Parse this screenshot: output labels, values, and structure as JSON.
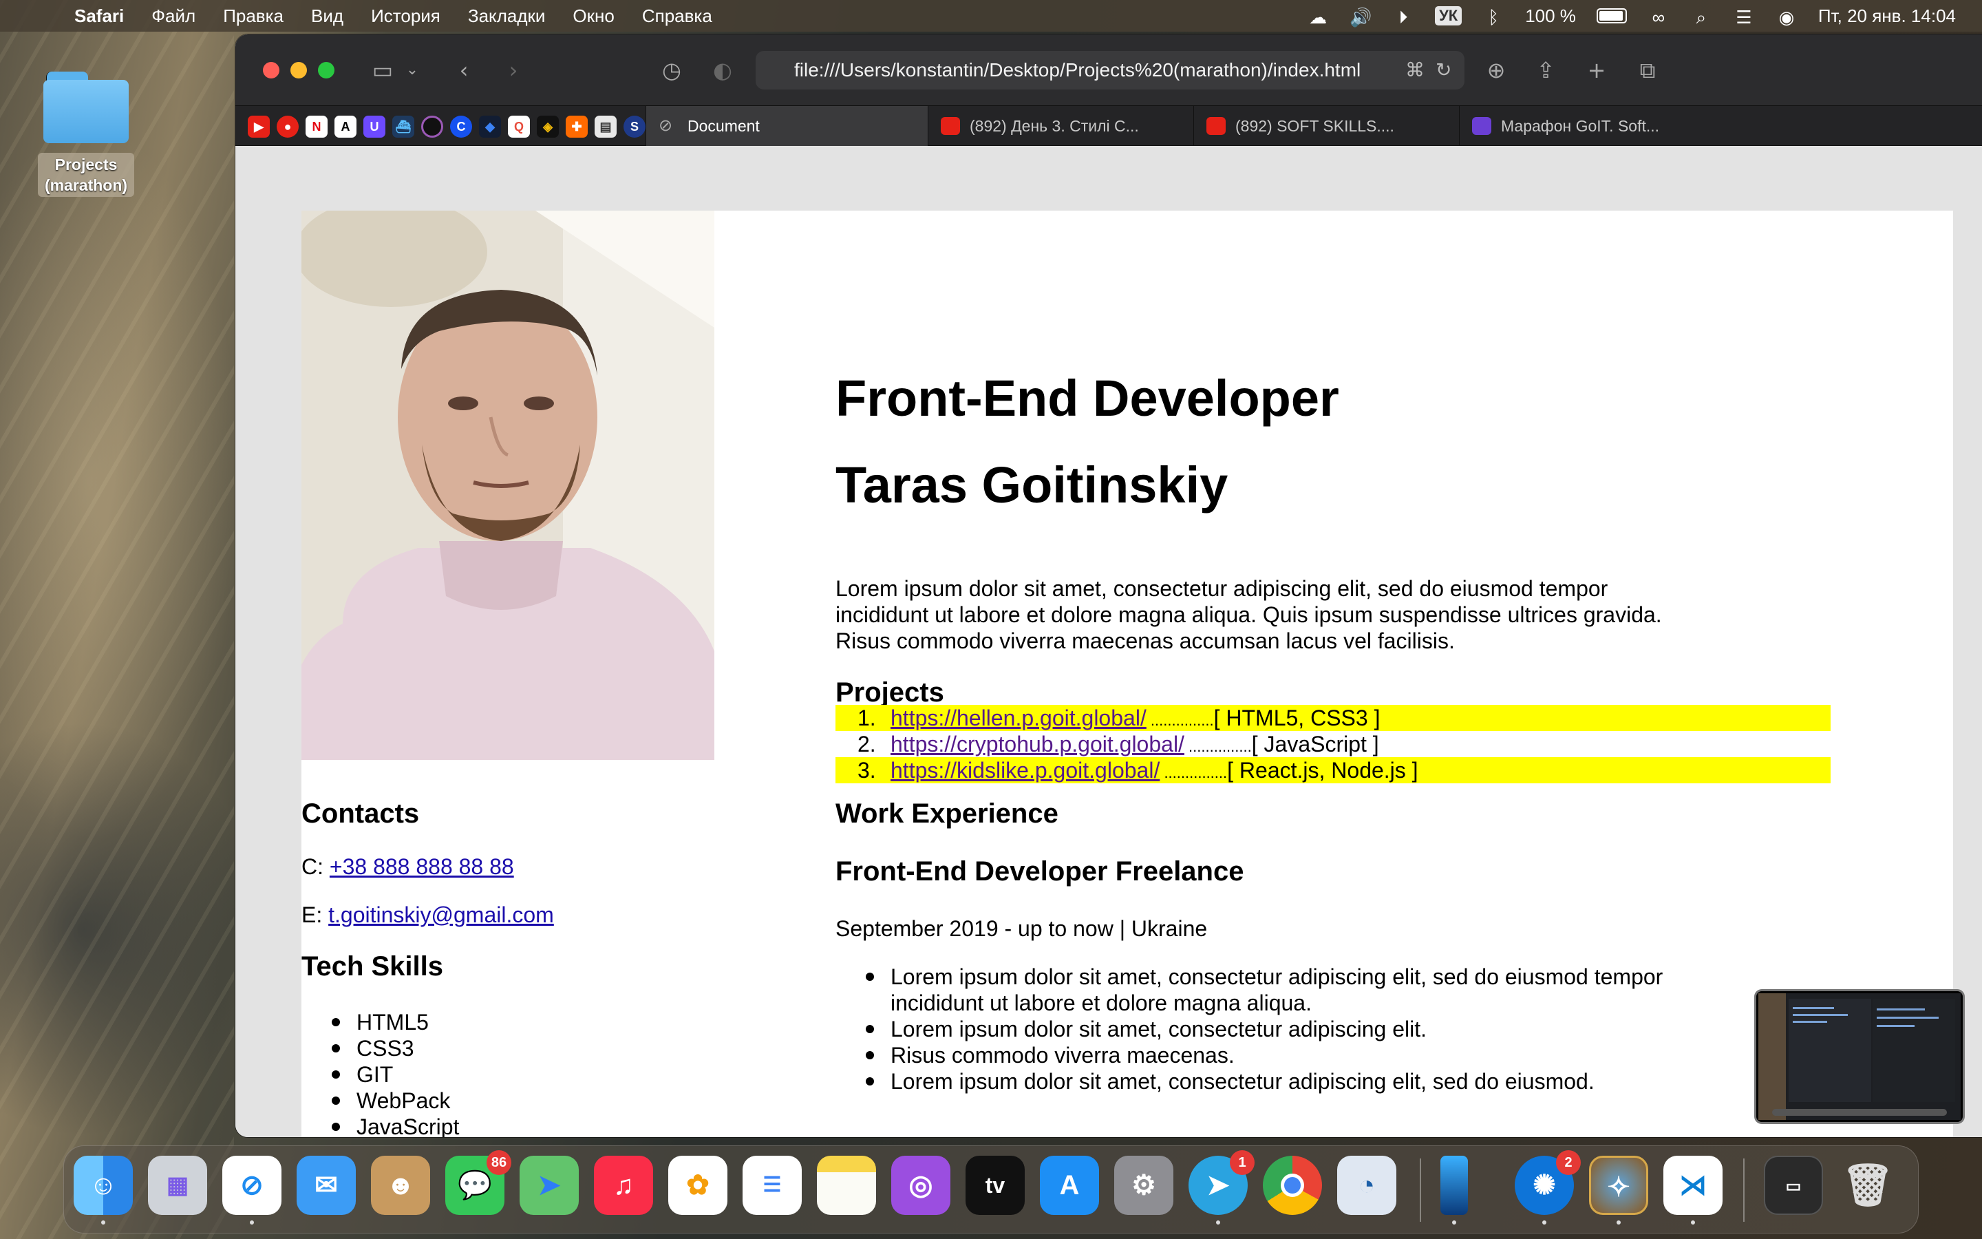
{
  "menubar": {
    "items": [
      "Safari",
      "Файл",
      "Правка",
      "Вид",
      "История",
      "Закладки",
      "Окно",
      "Справка"
    ],
    "keyboard": "УК",
    "battery": "100 %",
    "clock": "Пт, 20 янв.  14:04"
  },
  "desktop": {
    "folder_label": "Projects (marathon)"
  },
  "browser": {
    "url": "file:///Users/konstantin/Desktop/Projects%20(marathon)/index.html",
    "tabs": [
      {
        "label": "Document",
        "icon": "compass-icon"
      },
      {
        "label": "(892) День 3. Стилі С...",
        "icon": "youtube-icon"
      },
      {
        "label": "(892) SOFT SKILLS....",
        "icon": "youtube-icon"
      },
      {
        "label": "Марафон GoIT. Soft...",
        "icon": "form-icon"
      }
    ],
    "favorites": [
      "youtube",
      "youtube-music",
      "netflix",
      "arc",
      "proton-vpn",
      "boat",
      "color-wheel",
      "coinbase",
      "blockchain",
      "q-app",
      "binance",
      "plus-app",
      "docs",
      "s-app"
    ]
  },
  "resume": {
    "title": "Front-End Developer",
    "name": "Taras Goitinskiy",
    "intro": "Lorem ipsum dolor sit amet, consectetur adipiscing elit, sed do eiusmod tempor incididunt ut labore et dolore magna aliqua. Quis ipsum suspendisse ultrices gravida. Risus commodo viverra maecenas accumsan lacus vel facilisis.",
    "intro_lines": [
      "Lorem ipsum dolor sit amet, consectetur adipiscing elit, sed do eiusmod tempor",
      "incididunt ut labore et dolore magna aliqua. Quis ipsum suspendisse ultrices gravida.",
      "Risus commodo viverra maecenas accumsan lacus vel facilisis."
    ],
    "projects_heading": "Projects",
    "projects": [
      {
        "n": "1.",
        "url": "https://hellen.p.goit.global/",
        "dots": " ...............",
        "tech": "[ HTML5, CSS3 ]",
        "highlight": true
      },
      {
        "n": "2.",
        "url": "https://cryptohub.p.goit.global/",
        "dots": " ...............",
        "tech": "[ JavaScript ]",
        "highlight": false
      },
      {
        "n": "3.",
        "url": "https://kidslike.p.goit.global/",
        "dots": " ...............",
        "tech": "[ React.js, Node.js ]",
        "highlight": true
      }
    ],
    "work_heading": "Work Experience",
    "job_title": "Front-End Developer Freelance",
    "job_period": "September 2019 - up to now | Ukraine",
    "job_bullets": [
      "Lorem ipsum dolor sit amet, consectetur adipiscing elit, sed do eiusmod tempor",
      "incididunt ut labore et dolore magna aliqua.",
      "Lorem ipsum dolor sit amet, consectetur adipiscing elit.",
      "Risus commodo viverra maecenas.",
      "Lorem ipsum dolor sit amet, consectetur adipiscing elit, sed do eiusmod."
    ],
    "contacts_heading": "Contacts",
    "phone_prefix": "C: ",
    "phone": "+38 888 888 88 88",
    "email_prefix": "E: ",
    "email": "t.goitinskiy@gmail.com",
    "skills_heading": "Tech Skills",
    "skills": [
      "HTML5",
      "CSS3",
      "GIT",
      "WebPack",
      "JavaScript"
    ]
  },
  "dock": {
    "apps": [
      "Finder",
      "Launchpad",
      "Safari",
      "Mail",
      "Contacts",
      "Messages",
      "Maps",
      "Music",
      "Photos",
      "Reminders",
      "Notes",
      "Podcasts",
      "TV",
      "App Store",
      "System Settings",
      "Telegram",
      "Chrome",
      "Pockity",
      "Battle.net",
      "Hearthstone",
      "VS Code"
    ],
    "badges": {
      "messages": "86",
      "telegram": "1",
      "battlenet": "2"
    },
    "tv_label": "tv"
  }
}
